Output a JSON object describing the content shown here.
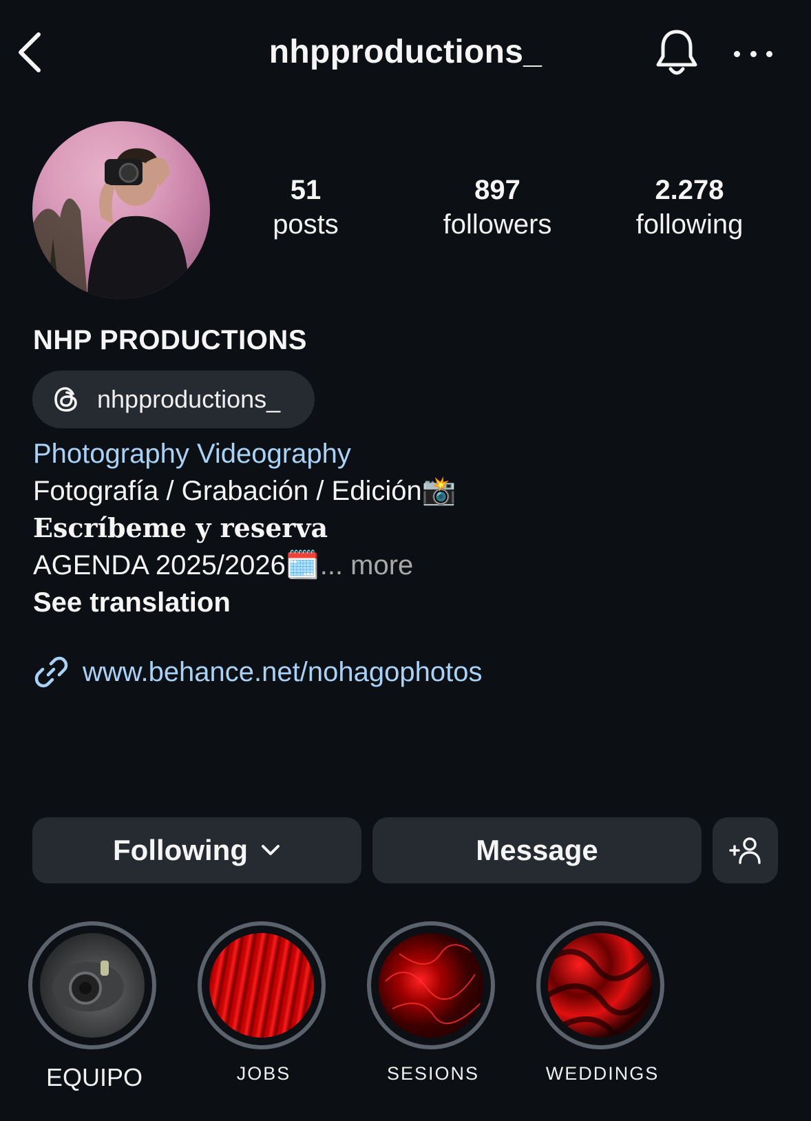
{
  "header": {
    "username": "nhpproductions_",
    "back_icon": "chevron-left-icon",
    "bell_icon": "bell-icon",
    "more_icon": "more-horizontal-icon"
  },
  "stats": [
    {
      "value": "51",
      "label": "posts"
    },
    {
      "value": "897",
      "label": "followers"
    },
    {
      "value": "2.278",
      "label": "following"
    }
  ],
  "profile": {
    "full_name": "NHP PRODUCTIONS",
    "threads_handle": "nhpproductions_",
    "category": "Photography Videography",
    "bio_line_1": "Fotografía / Grabación / Edición📸",
    "bio_line_2": "𝐄𝐬𝐜𝐫í𝐛𝐞𝐦𝐞 𝐲 𝐫𝐞𝐬𝐞𝐫𝐯𝐚",
    "bio_line_3": "AGENDA 2025/2026🗓️",
    "more_label": "... more",
    "see_translation": "See translation",
    "link": "www.behance.net/nohagophotos"
  },
  "actions": {
    "following_label": "Following",
    "message_label": "Message"
  },
  "highlights": [
    {
      "label": "EQUIPO"
    },
    {
      "label": "JOBS"
    },
    {
      "label": "SESIONS"
    },
    {
      "label": "WEDDINGS"
    }
  ],
  "colors": {
    "background": "#0c0f14",
    "button": "#262a31",
    "link": "#a9d2f7",
    "highlight_ring": "#5c626c"
  }
}
